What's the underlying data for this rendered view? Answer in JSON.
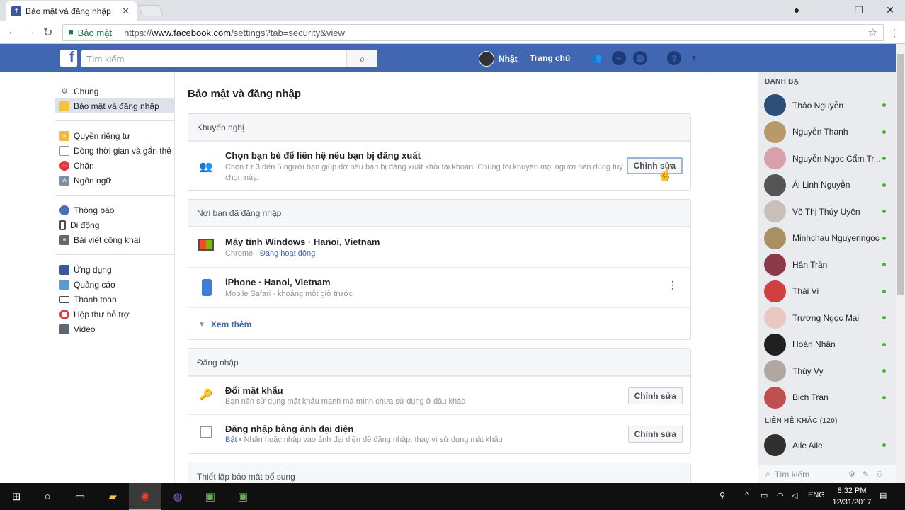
{
  "browser": {
    "tab_title": "Bảo mật và đăng nhập",
    "tab_favicon": "f",
    "secure_label": "Bảo mật",
    "url_prefix": "https://",
    "url_host": "www.facebook.com",
    "url_path": "/settings?tab=security&view"
  },
  "fb_header": {
    "logo": "f",
    "search_placeholder": "Tìm kiếm",
    "user_name": "Nhật",
    "home_label": "Trang chủ",
    "icons": [
      "friends-icon",
      "messenger-icon",
      "globe-icon",
      "help-icon",
      "caret-down-icon"
    ]
  },
  "left_nav": {
    "group1": [
      {
        "label": "Chung",
        "icon": "gear-icon"
      },
      {
        "label": "Bảo mật và đăng nhập",
        "icon": "shield-icon",
        "active": true
      }
    ],
    "group2": [
      {
        "label": "Quyền riêng tư",
        "icon": "lock-icon"
      },
      {
        "label": "Dòng thời gian và gắn thẻ",
        "icon": "timeline-icon"
      },
      {
        "label": "Chặn",
        "icon": "block-icon"
      },
      {
        "label": "Ngôn ngữ",
        "icon": "language-icon"
      }
    ],
    "group3": [
      {
        "label": "Thông báo",
        "icon": "globe-icon"
      },
      {
        "label": "Di động",
        "icon": "mobile-icon"
      },
      {
        "label": "Bài viết công khai",
        "icon": "rss-icon"
      }
    ],
    "group4": [
      {
        "label": "Ứng dụng",
        "icon": "apps-icon"
      },
      {
        "label": "Quảng cáo",
        "icon": "ads-icon"
      },
      {
        "label": "Thanh toán",
        "icon": "card-icon"
      },
      {
        "label": "Hộp thư hỗ trợ",
        "icon": "lifebuoy-icon"
      },
      {
        "label": "Video",
        "icon": "film-icon"
      }
    ]
  },
  "main": {
    "page_title": "Bảo mật và đăng nhập",
    "recommended": {
      "header": "Khuyến nghị",
      "title": "Chọn bạn bè để liên hệ nếu bạn bị đăng xuất",
      "subtitle": "Chọn từ 3 đến 5 người bạn giúp đỡ nếu bạn bị đăng xuất khỏi tài khoản. Chúng tôi khuyên mọi người nên dùng tùy chọn này.",
      "button": "Chỉnh sửa"
    },
    "where_logged_in": {
      "header": "Nơi bạn đã đăng nhập",
      "sessions": [
        {
          "title": "Máy tính Windows · Hanoi, Vietnam",
          "browser": "Chrome",
          "status": "Đang hoạt động",
          "icon": "monitor-icon"
        },
        {
          "title": "iPhone · Hanoi, Vietnam",
          "browser": "Mobile Safari",
          "status": "khoảng một giờ trước",
          "icon": "phone-icon"
        }
      ],
      "see_more": "Xem thêm"
    },
    "login": {
      "header": "Đăng nhập",
      "rows": [
        {
          "title": "Đổi mật khẩu",
          "subtitle": "Bạn nên sử dụng mật khẩu mạnh mà mình chưa sử dụng ở đâu khác",
          "button": "Chỉnh sửa",
          "icon": "key-icon"
        },
        {
          "title": "Đăng nhập bằng ảnh đại diện",
          "status": "Bật",
          "subtitle": "Nhấn hoặc nhập vào ảnh đại diện để đăng nhập, thay vì sử dụng mật khẩu",
          "button": "Chỉnh sửa",
          "icon": "profile-pic-icon"
        }
      ]
    },
    "extra_security": {
      "header": "Thiết lập bảo mật bổ sung"
    }
  },
  "chat": {
    "contacts_header": "DANH BẠ",
    "contacts": [
      {
        "name": "Thảo Nguyễn",
        "color": "#2c4f7a"
      },
      {
        "name": "Nguyễn Thanh",
        "color": "#b89a6a"
      },
      {
        "name": "Nguyễn Ngọc Cẩm Tr...",
        "color": "#d8a0a8"
      },
      {
        "name": "Ái Linh Nguyễn",
        "color": "#555555"
      },
      {
        "name": "Võ Thị Thúy Uyên",
        "color": "#c8c0b8"
      },
      {
        "name": "Minhchau Nguyenngoc",
        "color": "#a89060"
      },
      {
        "name": "Hân Trần",
        "color": "#8c3a4a"
      },
      {
        "name": "Thái Vi",
        "color": "#d04040"
      },
      {
        "name": "Trương Ngọc Mai",
        "color": "#e8c8c0"
      },
      {
        "name": "Hoàn Nhân",
        "color": "#202020"
      },
      {
        "name": "Thúy Vy",
        "color": "#b0a8a0"
      },
      {
        "name": "Bich Tran",
        "color": "#c05050"
      }
    ],
    "other_header": "LIÊN HỆ KHÁC (120)",
    "other_contacts": [
      {
        "name": "Aile Aile",
        "color": "#303030"
      }
    ],
    "search_placeholder": "Tìm kiếm"
  },
  "taskbar": {
    "language": "ENG",
    "time": "8:32 PM",
    "date": "12/31/2017"
  }
}
